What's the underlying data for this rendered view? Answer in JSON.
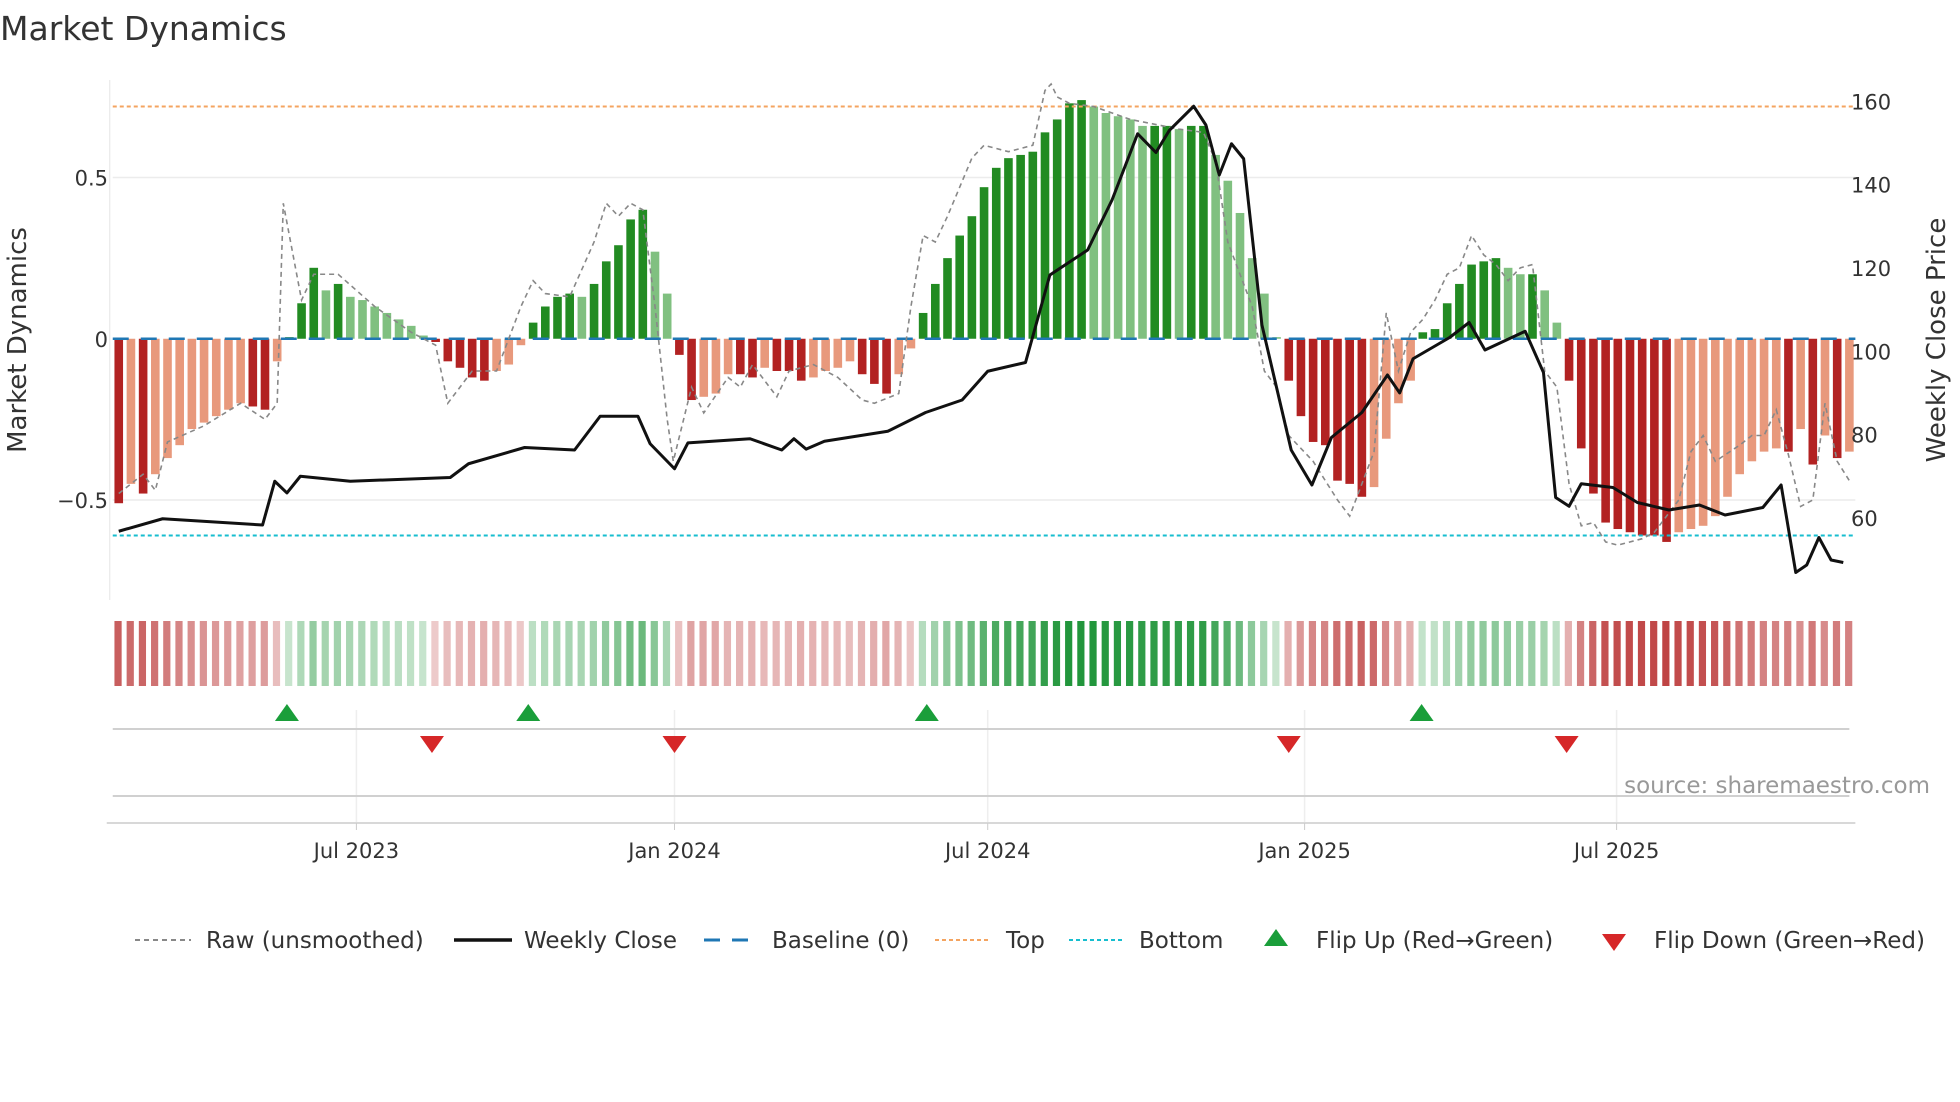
{
  "title": "Market Dynamics",
  "source": "source: sharemaestro.com",
  "colors": {
    "dark_red": "#b22222",
    "light_red": "#e8997c",
    "dark_green": "#228b22",
    "light_green": "#80c080",
    "close": "#111111",
    "raw": "#888888",
    "baseline": "#1f77b4",
    "top": "#f4a460",
    "bottom": "#17becf",
    "flip_up": "#1a9e3a",
    "flip_down": "#d62728"
  },
  "chart_data": {
    "type": "bar",
    "title": "Market Dynamics",
    "ylabel": "Market Dynamics",
    "y2label": "Weekly Close Price",
    "x_unit": "week index (weekly bars, ~Feb 2023 to Nov 2025)",
    "ylim": [
      -0.82,
      0.8
    ],
    "y2lim": [
      44,
      164
    ],
    "yticks": [
      {
        "v": 0.5,
        "label": "0.5"
      },
      {
        "v": 0,
        "label": "0"
      },
      {
        "v": -0.5,
        "label": "−0.5"
      }
    ],
    "y2ticks": [
      {
        "v": 160,
        "label": "160"
      },
      {
        "v": 140,
        "label": "140"
      },
      {
        "v": 120,
        "label": "120"
      },
      {
        "v": 100,
        "label": "100"
      },
      {
        "v": 80,
        "label": "80"
      },
      {
        "v": 60,
        "label": "60"
      }
    ],
    "xticks": [
      {
        "w": 19.5,
        "label": "Jul 2023"
      },
      {
        "w": 45.6,
        "label": "Jan 2024"
      },
      {
        "w": 71.3,
        "label": "Jul 2024"
      },
      {
        "w": 97.3,
        "label": "Jan 2025"
      },
      {
        "w": 122.9,
        "label": "Jul 2025"
      }
    ],
    "top_level": 0.72,
    "bottom_level": -0.61,
    "market_dynamics": [
      -0.51,
      -0.45,
      -0.48,
      -0.42,
      -0.37,
      -0.33,
      -0.28,
      -0.26,
      -0.24,
      -0.22,
      -0.2,
      -0.21,
      -0.22,
      -0.07,
      0.005,
      0.11,
      0.22,
      0.15,
      0.17,
      0.13,
      0.12,
      0.1,
      0.08,
      0.06,
      0.04,
      0.01,
      -0.01,
      -0.07,
      -0.09,
      -0.12,
      -0.13,
      -0.1,
      -0.08,
      -0.02,
      0.05,
      0.1,
      0.13,
      0.14,
      0.13,
      0.17,
      0.24,
      0.29,
      0.37,
      0.4,
      0.27,
      0.14,
      -0.05,
      -0.19,
      -0.18,
      -0.17,
      -0.11,
      -0.11,
      -0.12,
      -0.09,
      -0.1,
      -0.1,
      -0.13,
      -0.12,
      -0.1,
      -0.09,
      -0.07,
      -0.11,
      -0.14,
      -0.17,
      -0.11,
      -0.03,
      0.08,
      0.17,
      0.25,
      0.32,
      0.38,
      0.47,
      0.53,
      0.56,
      0.57,
      0.58,
      0.64,
      0.68,
      0.73,
      0.74,
      0.72,
      0.7,
      0.69,
      0.68,
      0.66,
      0.66,
      0.66,
      0.65,
      0.66,
      0.66,
      0.57,
      0.49,
      0.39,
      0.25,
      0.14,
      0.005,
      -0.13,
      -0.24,
      -0.32,
      -0.33,
      -0.44,
      -0.45,
      -0.49,
      -0.46,
      -0.31,
      -0.2,
      -0.13,
      0.02,
      0.03,
      0.11,
      0.17,
      0.23,
      0.24,
      0.25,
      0.22,
      0.2,
      0.2,
      0.15,
      0.05,
      -0.13,
      -0.34,
      -0.48,
      -0.57,
      -0.59,
      -0.6,
      -0.61,
      -0.61,
      -0.63,
      -0.6,
      -0.59,
      -0.58,
      -0.55,
      -0.49,
      -0.42,
      -0.38,
      -0.35,
      -0.34,
      -0.35,
      -0.28,
      -0.39,
      -0.3,
      -0.37,
      -0.35
    ],
    "raw": [
      [
        0,
        -0.48
      ],
      [
        2,
        -0.42
      ],
      [
        3,
        -0.47
      ],
      [
        4,
        -0.32
      ],
      [
        7,
        -0.27
      ],
      [
        10,
        -0.2
      ],
      [
        12,
        -0.25
      ],
      [
        13,
        -0.2
      ],
      [
        13.5,
        0.42
      ],
      [
        15,
        0.12
      ],
      [
        16,
        0.2
      ],
      [
        18,
        0.2
      ],
      [
        21,
        0.1
      ],
      [
        24,
        0.02
      ],
      [
        26,
        -0.02
      ],
      [
        27,
        -0.2
      ],
      [
        29,
        -0.1
      ],
      [
        31,
        -0.1
      ],
      [
        33,
        0.1
      ],
      [
        34,
        0.18
      ],
      [
        35,
        0.14
      ],
      [
        37,
        0.13
      ],
      [
        39,
        0.3
      ],
      [
        40,
        0.42
      ],
      [
        41,
        0.38
      ],
      [
        42,
        0.42
      ],
      [
        43,
        0.4
      ],
      [
        44,
        0.1
      ],
      [
        45,
        -0.25
      ],
      [
        45.5,
        -0.38
      ],
      [
        47,
        -0.15
      ],
      [
        48,
        -0.23
      ],
      [
        50,
        -0.12
      ],
      [
        51,
        -0.15
      ],
      [
        52,
        -0.08
      ],
      [
        54,
        -0.18
      ],
      [
        55,
        -0.1
      ],
      [
        57,
        -0.08
      ],
      [
        59,
        -0.12
      ],
      [
        61,
        -0.19
      ],
      [
        62,
        -0.2
      ],
      [
        64,
        -0.17
      ],
      [
        65,
        0.1
      ],
      [
        66,
        0.32
      ],
      [
        67,
        0.3
      ],
      [
        68,
        0.38
      ],
      [
        70,
        0.56
      ],
      [
        71,
        0.6
      ],
      [
        73,
        0.58
      ],
      [
        75,
        0.6
      ],
      [
        76,
        0.77
      ],
      [
        76.5,
        0.79
      ],
      [
        77,
        0.75
      ],
      [
        78,
        0.73
      ],
      [
        80,
        0.72
      ],
      [
        83,
        0.68
      ],
      [
        87,
        0.65
      ],
      [
        89,
        0.64
      ],
      [
        90,
        0.55
      ],
      [
        91,
        0.3
      ],
      [
        92,
        0.2
      ],
      [
        93,
        0.1
      ],
      [
        94,
        -0.1
      ],
      [
        95,
        -0.15
      ],
      [
        96,
        -0.3
      ],
      [
        98,
        -0.38
      ],
      [
        100,
        -0.5
      ],
      [
        101,
        -0.55
      ],
      [
        102,
        -0.45
      ],
      [
        103,
        -0.35
      ],
      [
        104,
        0.08
      ],
      [
        105,
        -0.1
      ],
      [
        106,
        0.02
      ],
      [
        107,
        0.06
      ],
      [
        108,
        0.12
      ],
      [
        109,
        0.2
      ],
      [
        110,
        0.22
      ],
      [
        111,
        0.32
      ],
      [
        112,
        0.26
      ],
      [
        113,
        0.23
      ],
      [
        114,
        0.18
      ],
      [
        115,
        0.22
      ],
      [
        116,
        0.23
      ],
      [
        117,
        -0.1
      ],
      [
        118,
        -0.15
      ],
      [
        119,
        -0.45
      ],
      [
        120,
        -0.58
      ],
      [
        121,
        -0.57
      ],
      [
        122,
        -0.63
      ],
      [
        123,
        -0.64
      ],
      [
        125,
        -0.62
      ],
      [
        126,
        -0.6
      ],
      [
        127,
        -0.55
      ],
      [
        128,
        -0.5
      ],
      [
        129,
        -0.35
      ],
      [
        130,
        -0.3
      ],
      [
        131,
        -0.38
      ],
      [
        133,
        -0.33
      ],
      [
        134,
        -0.3
      ],
      [
        135,
        -0.3
      ],
      [
        136,
        -0.22
      ],
      [
        137,
        -0.36
      ],
      [
        138,
        -0.52
      ],
      [
        139,
        -0.5
      ],
      [
        140,
        -0.2
      ],
      [
        141,
        -0.38
      ],
      [
        142,
        -0.44
      ]
    ],
    "weekly_close": [
      [
        0,
        56.8
      ],
      [
        3.6,
        59.8
      ],
      [
        11.8,
        58.3
      ],
      [
        12.8,
        68.8
      ],
      [
        13.8,
        66
      ],
      [
        14.9,
        70
      ],
      [
        19,
        68.8
      ],
      [
        27.2,
        69.7
      ],
      [
        28.7,
        73
      ],
      [
        33.3,
        76.9
      ],
      [
        37.4,
        76.3
      ],
      [
        39.5,
        84.4
      ],
      [
        42.6,
        84.4
      ],
      [
        43.6,
        77.8
      ],
      [
        45.6,
        71.8
      ],
      [
        46.7,
        78
      ],
      [
        51.8,
        79
      ],
      [
        54.4,
        76.3
      ],
      [
        55.4,
        79
      ],
      [
        56.4,
        76.5
      ],
      [
        57.9,
        78.4
      ],
      [
        63.1,
        80.8
      ],
      [
        66.2,
        85.3
      ],
      [
        69.2,
        88.3
      ],
      [
        71.3,
        95.2
      ],
      [
        74.4,
        97.3
      ],
      [
        76.4,
        118.3
      ],
      [
        79.5,
        124.3
      ],
      [
        81.5,
        136.3
      ],
      [
        83.6,
        152.2
      ],
      [
        85.1,
        147.7
      ],
      [
        86.2,
        153
      ],
      [
        88.2,
        158.8
      ],
      [
        89.2,
        154.3
      ],
      [
        90.3,
        142.3
      ],
      [
        91.3,
        149.8
      ],
      [
        92.3,
        146.2
      ],
      [
        93.8,
        106.3
      ],
      [
        96.2,
        76.3
      ],
      [
        97.9,
        67.9
      ],
      [
        99.5,
        79.3
      ],
      [
        102,
        85.3
      ],
      [
        104.1,
        94.3
      ],
      [
        105.1,
        90
      ],
      [
        106.2,
        98.2
      ],
      [
        109.2,
        103.3
      ],
      [
        110.8,
        106.9
      ],
      [
        112.1,
        100.3
      ],
      [
        115.4,
        104.8
      ],
      [
        116.9,
        94.9
      ],
      [
        117.9,
        64.9
      ],
      [
        119,
        62.8
      ],
      [
        120,
        68.2
      ],
      [
        122.6,
        67.3
      ],
      [
        124.6,
        63.7
      ],
      [
        127.2,
        61.9
      ],
      [
        129.7,
        63.1
      ],
      [
        131.8,
        60.7
      ],
      [
        134.9,
        62.5
      ],
      [
        136.4,
        67.9
      ],
      [
        137.6,
        46.9
      ],
      [
        138.5,
        48.7
      ],
      [
        139.5,
        55.3
      ],
      [
        140.5,
        49.9
      ],
      [
        141.5,
        49.3
      ]
    ],
    "flip_up_weeks": [
      13.8,
      33.6,
      66.3,
      106.9
    ],
    "flip_down_weeks": [
      25.7,
      45.6,
      96.0,
      118.8
    ]
  },
  "legend": {
    "raw": "Raw (unsmoothed)",
    "close": "Weekly Close",
    "baseline": "Baseline (0)",
    "top": "Top",
    "bottom": "Bottom",
    "flip_up": "Flip Up (Red→Green)",
    "flip_down": "Flip Down (Green→Red)"
  }
}
